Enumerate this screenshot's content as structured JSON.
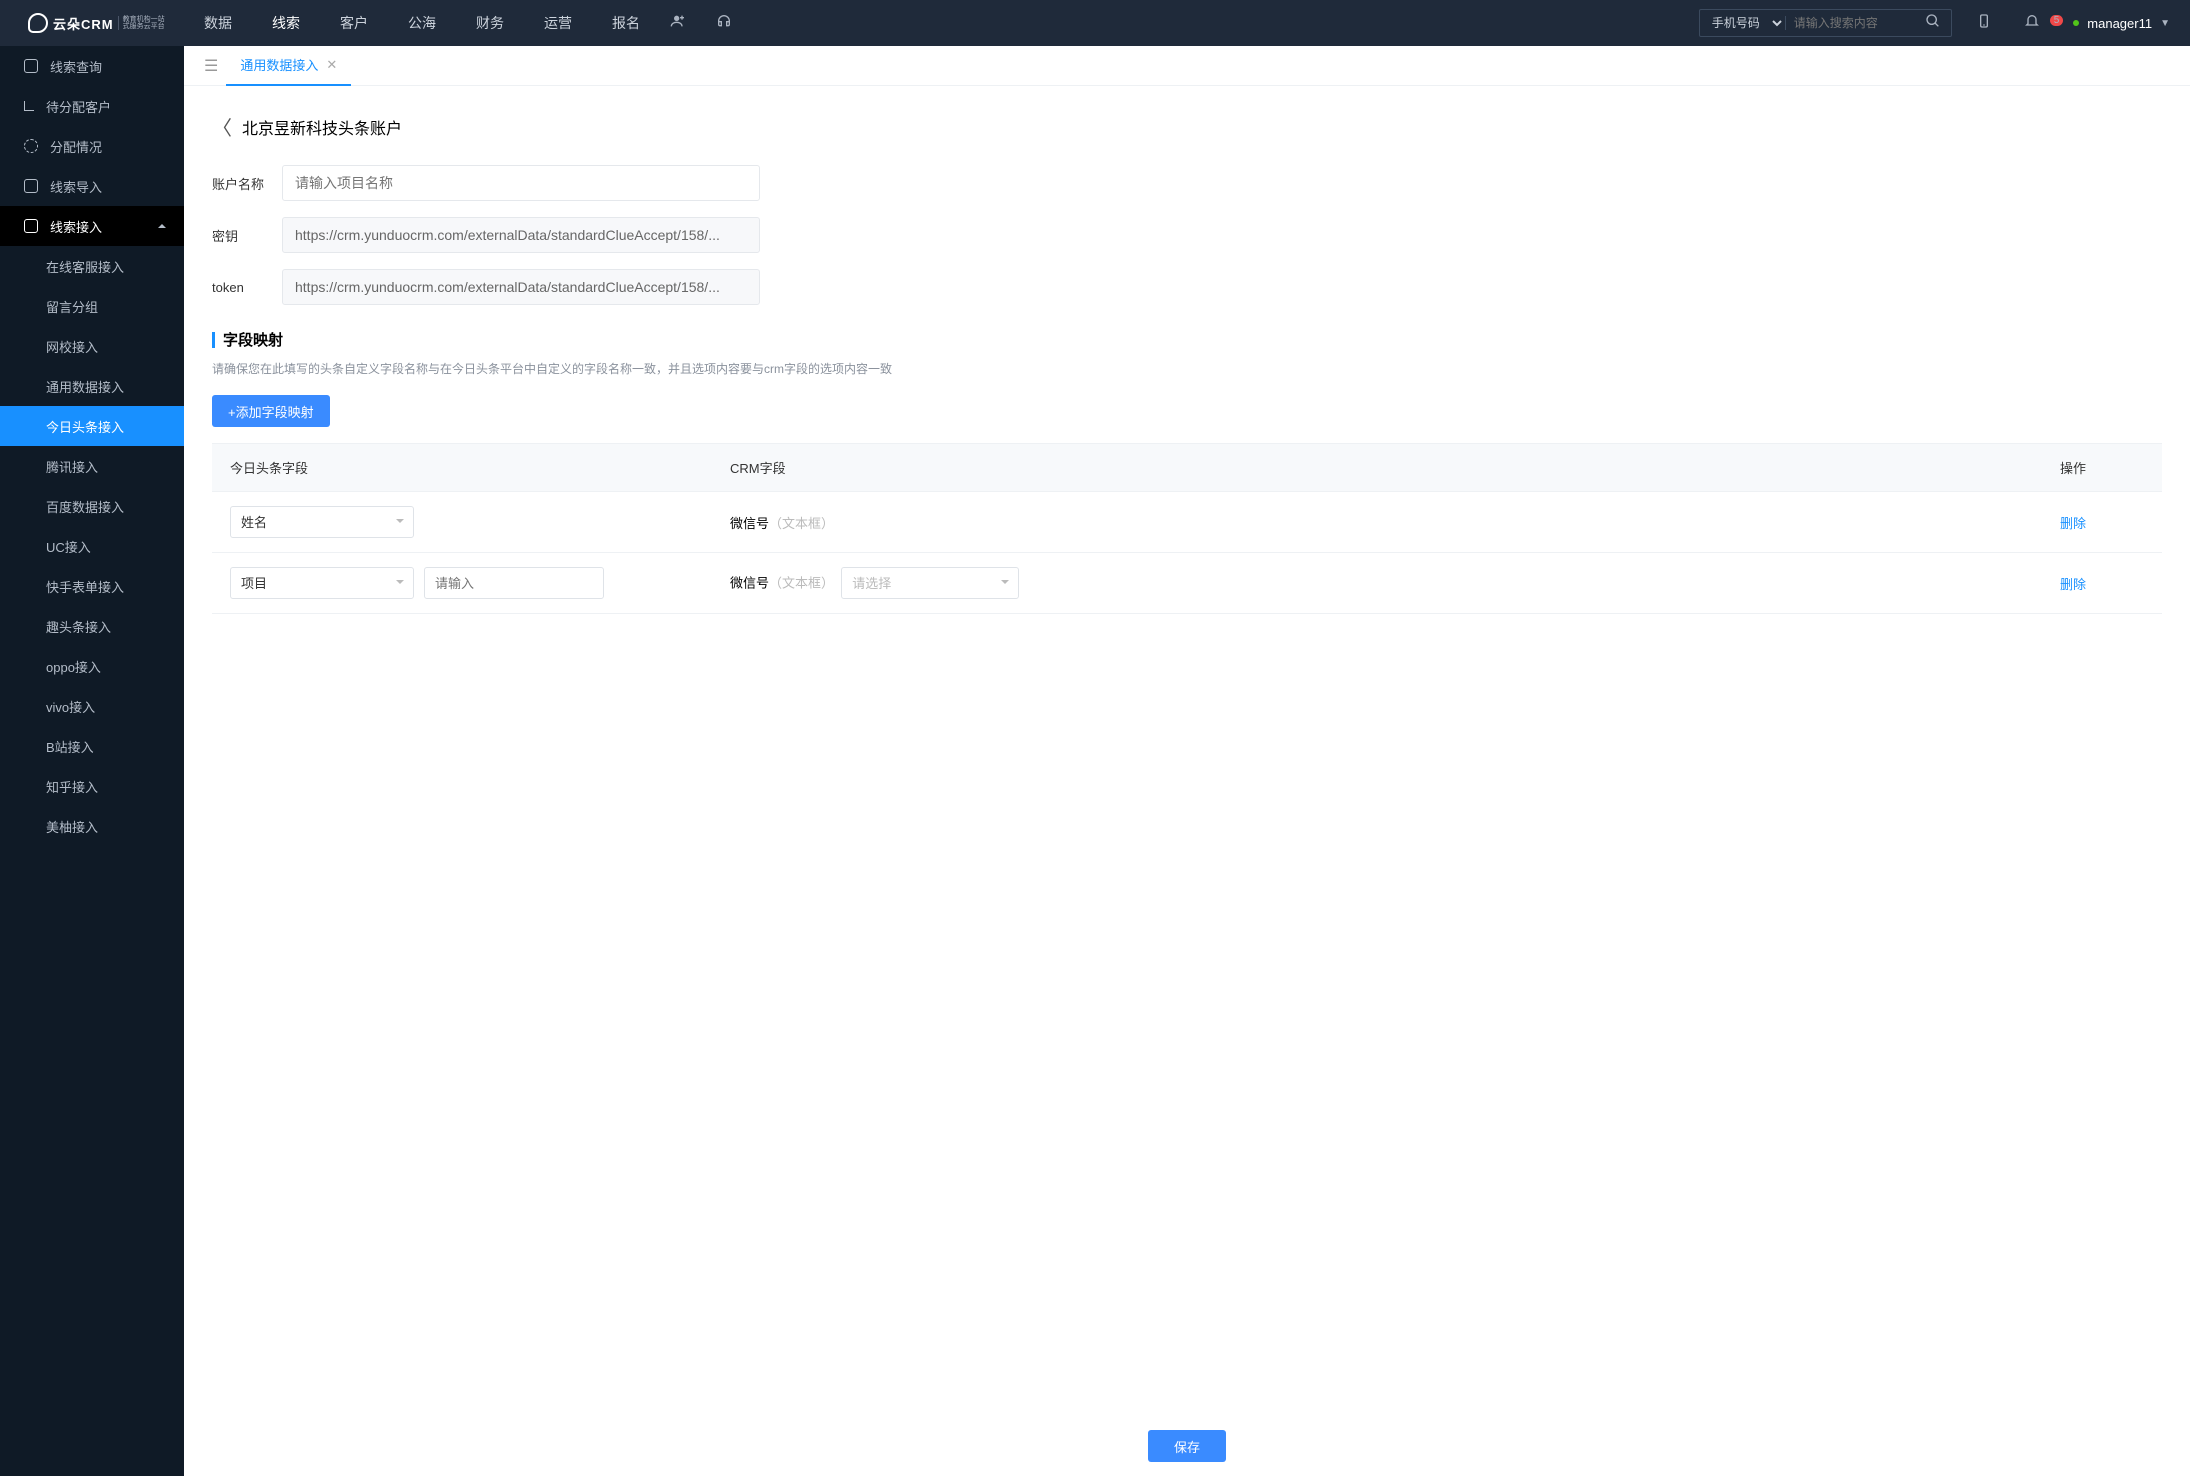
{
  "header": {
    "brand": "云朵CRM",
    "brand_sub1": "教育机构一站",
    "brand_sub2": "式服务云平台",
    "nav": [
      "数据",
      "线索",
      "客户",
      "公海",
      "财务",
      "运营",
      "报名"
    ],
    "nav_active": "线索",
    "search_type_options": [
      "手机号码"
    ],
    "search_type": "手机号码",
    "search_placeholder": "请输入搜索内容",
    "notif_count": "5",
    "username": "manager11"
  },
  "sidebar": {
    "items": [
      {
        "label": "线索查询"
      },
      {
        "label": "待分配客户"
      },
      {
        "label": "分配情况"
      },
      {
        "label": "线索导入"
      }
    ],
    "group_label": "线索接入",
    "subs": [
      "在线客服接入",
      "留言分组",
      "网校接入",
      "通用数据接入",
      "今日头条接入",
      "腾讯接入",
      "百度数据接入",
      "UC接入",
      "快手表单接入",
      "趣头条接入",
      "oppo接入",
      "vivo接入",
      "B站接入",
      "知乎接入",
      "美柚接入"
    ],
    "sub_active": "今日头条接入"
  },
  "tab_label": "通用数据接入",
  "page": {
    "title": "北京昱新科技头条账户",
    "form": {
      "name_label": "账户名称",
      "name_placeholder": "请输入项目名称",
      "name_value": "",
      "key_label": "密钥",
      "key_value": "https://crm.yunduocrm.com/externalData/standardClueAccept/158/...",
      "token_label": "token",
      "token_value": "https://crm.yunduocrm.com/externalData/standardClueAccept/158/..."
    },
    "section_title": "字段映射",
    "section_hint": "请确保您在此填写的头条自定义字段名称与在今日头条平台中自定义的字段名称一致，并且选项内容要与crm字段的选项内容一致",
    "add_btn": "+添加字段映射",
    "cols": {
      "c1": "今日头条字段",
      "c2": "CRM字段",
      "c3": "操作"
    },
    "rows": [
      {
        "tt_field": "姓名",
        "crm_field": "微信号",
        "crm_type": "（文本框）",
        "extra_input": false,
        "extra_select": false
      },
      {
        "tt_field": "项目",
        "crm_field": "微信号",
        "crm_type": "（文本框）",
        "extra_input": true,
        "extra_input_placeholder": "请输入",
        "extra_select": true,
        "extra_select_placeholder": "请选择"
      }
    ],
    "row_delete": "删除",
    "save_btn": "保存"
  }
}
